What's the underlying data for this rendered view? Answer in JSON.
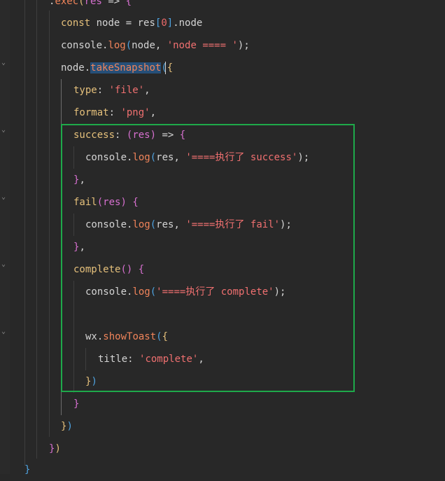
{
  "code": {
    "line_exec": {
      "dot": ".",
      "fn": "exec",
      "open": "(",
      "param": "res",
      "arrow": " => ",
      "brace": "{"
    },
    "line_const": {
      "kw": "const",
      "rest1": " node = res",
      "b1": "[",
      "idx": "0",
      "b2": "]",
      "rest2": ".node"
    },
    "line_log1": {
      "obj": "console.",
      "fn": "log",
      "open": "(",
      "args": "node, ",
      "str": "'node ==== '",
      "close": ");"
    },
    "line_snap": {
      "obj": "node.",
      "fn": "takeSnapshot",
      "open": "(",
      "brace": "{"
    },
    "line_type": {
      "key": "type",
      "colon": ": ",
      "str": "'file'",
      "comma": ","
    },
    "line_format": {
      "key": "format",
      "colon": ": ",
      "str": "'png'",
      "comma": ","
    },
    "line_success": {
      "key": "success",
      "colon": ": ",
      "open": "(",
      "param": "res",
      "close": ")",
      "arrow": " => ",
      "brace": "{"
    },
    "line_log2": {
      "obj": "console.",
      "fn": "log",
      "open": "(",
      "args": "res, ",
      "str": "'====执行了 success'",
      "close": ");"
    },
    "line_close1": {
      "brace": "}",
      "comma": ","
    },
    "line_fail": {
      "fn": "fail",
      "open": "(",
      "param": "res",
      "close": ")",
      "space": " ",
      "brace": "{"
    },
    "line_log3": {
      "obj": "console.",
      "fn": "log",
      "open": "(",
      "args": "res, ",
      "str": "'====执行了 fail'",
      "close": ");"
    },
    "line_close2": {
      "brace": "}",
      "comma": ","
    },
    "line_complete": {
      "fn": "complete",
      "parens": "()",
      "space": " ",
      "brace": "{"
    },
    "line_log4": {
      "obj": "console.",
      "fn": "log",
      "open": "(",
      "str": "'====执行了 complete'",
      "close": ");"
    },
    "line_toast": {
      "obj": "wx.",
      "fn": "showToast",
      "open": "(",
      "brace": "{"
    },
    "line_title": {
      "key": "title",
      "colon": ": ",
      "str": "'complete'",
      "comma": ","
    },
    "line_close3": {
      "brace": "}",
      "paren": ")"
    },
    "line_close4": {
      "brace": "}"
    },
    "line_close5": {
      "brace": "}",
      "paren": ")"
    },
    "line_close6": {
      "brace": "}",
      "paren": ")"
    },
    "line_close7": {
      "brace": "}"
    }
  },
  "colors": {
    "background": "#282828",
    "highlight_border": "#1ea94a",
    "selection": "#264f78"
  }
}
